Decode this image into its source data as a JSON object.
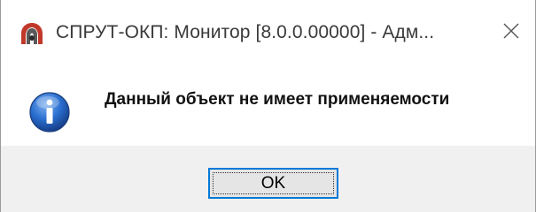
{
  "window": {
    "title": "СПРУТ-ОКП: Монитор [8.0.0.00000] - Адм...",
    "app_icon": "sprut-app-icon",
    "close_icon": "close-icon"
  },
  "dialog": {
    "icon": "info-icon",
    "message": "Данный объект не имеет применяемости",
    "ok_label": "OK"
  },
  "colors": {
    "accent": "#0078d7",
    "info_icon_blue": "#1f5fc0",
    "app_icon_red": "#c0392b"
  }
}
